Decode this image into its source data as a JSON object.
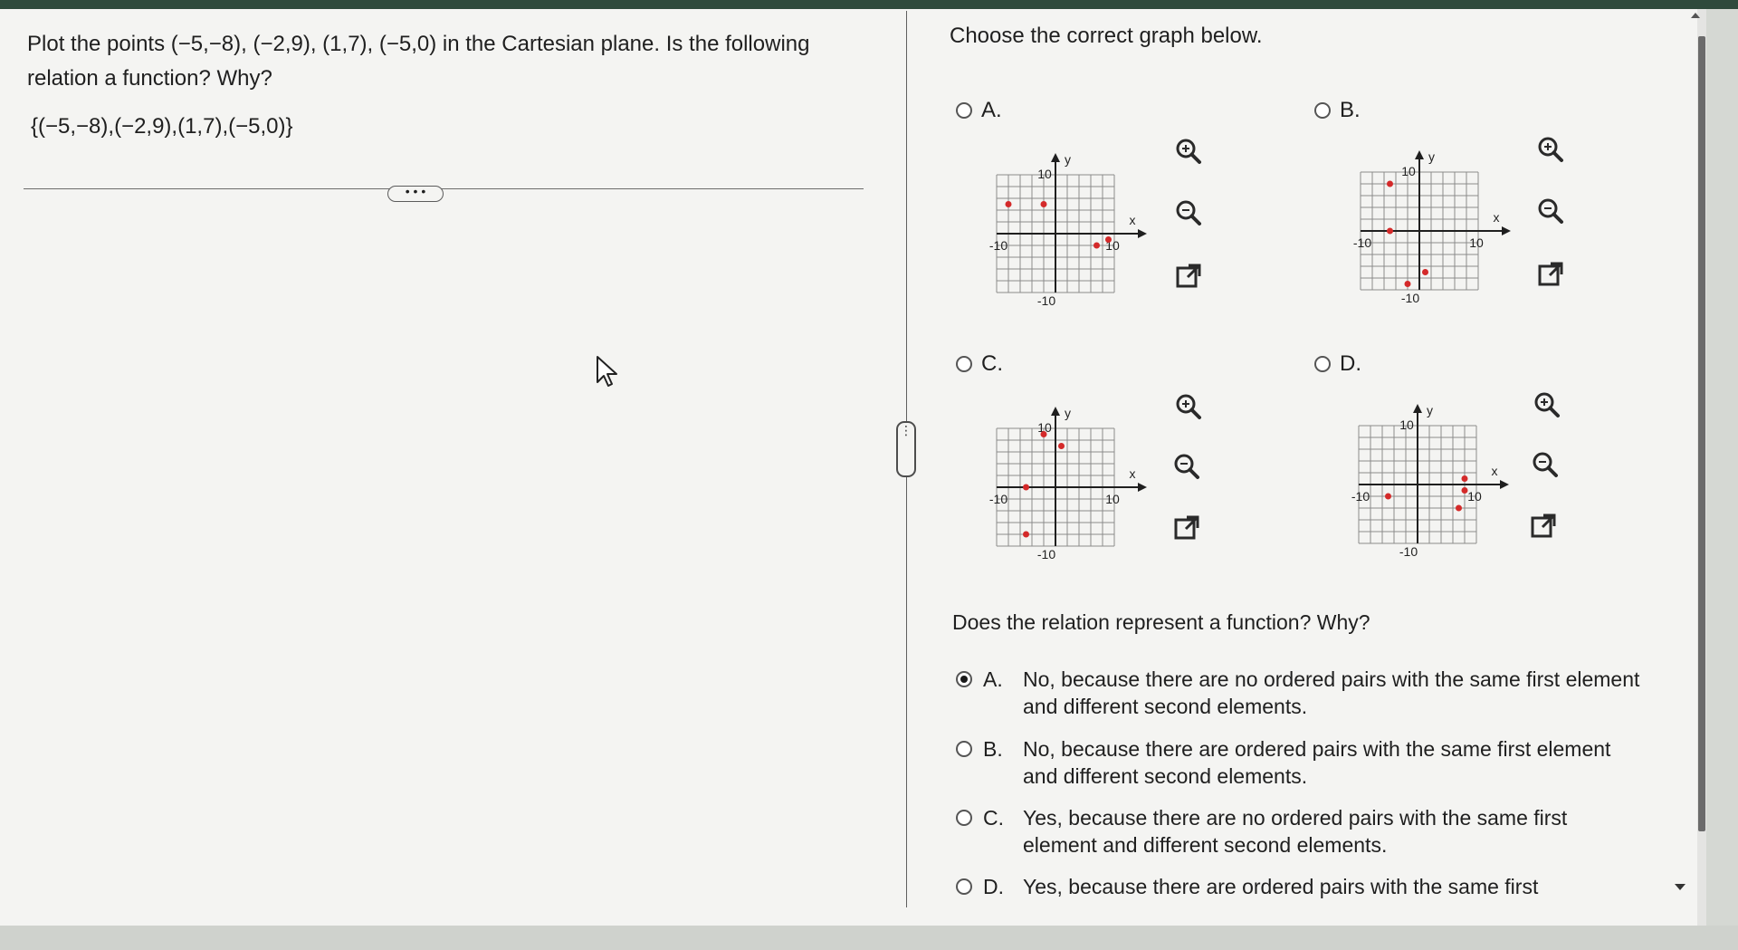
{
  "question": {
    "text": "Plot the points (−5,−8), (−2,9), (1,7), (−5,0) in the Cartesian plane. Is the following relation a function? Why?",
    "set": "{(−5,−8),(−2,9),(1,7),(−5,0)}"
  },
  "more_button": "• • •",
  "side_handle": "⋮",
  "graphs": {
    "prompt": "Choose the correct graph below.",
    "axis_x": "x",
    "axis_y": "y",
    "tick_max": "10",
    "tick_min": "-10",
    "options": [
      {
        "letter": "A.",
        "points": [
          [
            -8,
            5
          ],
          [
            -2,
            5
          ],
          [
            9,
            -1
          ],
          [
            7,
            -2
          ]
        ]
      },
      {
        "letter": "B.",
        "points": [
          [
            -5,
            8
          ],
          [
            -5,
            0
          ],
          [
            1,
            -7
          ],
          [
            -2,
            -9
          ]
        ]
      },
      {
        "letter": "C.",
        "points": [
          [
            -2,
            9
          ],
          [
            1,
            7
          ],
          [
            -5,
            -8
          ],
          [
            -5,
            0
          ]
        ]
      },
      {
        "letter": "D.",
        "points": [
          [
            8,
            1
          ],
          [
            8,
            -1
          ],
          [
            -5,
            -2
          ],
          [
            7,
            -4
          ]
        ]
      }
    ],
    "tools": {
      "zoom_in": "zoom-in-icon",
      "zoom_out": "zoom-out-icon",
      "popout": "popout-icon"
    }
  },
  "function_question": {
    "prompt": "Does the relation represent a function? Why?",
    "selected": "A.",
    "answers": [
      {
        "letter": "A.",
        "text": "No, because there are no ordered pairs with the same first element and different second elements."
      },
      {
        "letter": "B.",
        "text": "No, because there are ordered pairs with the same first element and different second elements."
      },
      {
        "letter": "C.",
        "text": "Yes, because there are no ordered pairs with the same first element and different second elements."
      },
      {
        "letter": "D.",
        "text": "Yes, because there are ordered pairs with the same first"
      }
    ]
  },
  "colors": {
    "point": "#d42a2a",
    "grid": "#8b8b8b",
    "axis": "#1f1f1f",
    "selected_radio": "#1a1a1a"
  }
}
